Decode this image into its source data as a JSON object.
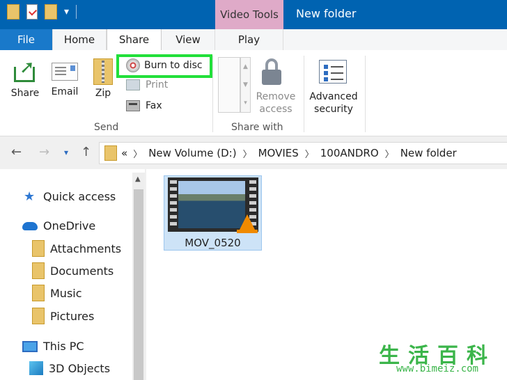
{
  "titlebar": {
    "context_tab": "Video Tools",
    "window_title": "New folder",
    "accent_color": "#0063b1",
    "context_color": "#dfaac8"
  },
  "tabs": {
    "file": "File",
    "home": "Home",
    "share": "Share",
    "view": "View",
    "play": "Play"
  },
  "ribbon": {
    "send": {
      "share": "Share",
      "email": "Email",
      "zip": "Zip",
      "burn": "Burn to disc",
      "print": "Print",
      "fax": "Fax",
      "group_label": "Send"
    },
    "share_with": {
      "remove_line1": "Remove",
      "remove_line2": "access",
      "advanced_line1": "Advanced",
      "advanced_line2": "security",
      "group_label": "Share with"
    },
    "highlight_color": "#22e03a"
  },
  "address": {
    "overflow": "«",
    "crumbs": [
      "New Volume (D:)",
      "MOVIES",
      "100ANDRO",
      "New folder"
    ]
  },
  "nav": {
    "quick_access": "Quick access",
    "onedrive": "OneDrive",
    "folders": [
      "Attachments",
      "Documents",
      "Music",
      "Pictures"
    ],
    "this_pc": "This PC",
    "objects_3d": "3D Objects"
  },
  "files": [
    {
      "name": "MOV_0520",
      "icon": "vlc-cone-icon"
    }
  ],
  "watermark": {
    "chars": "生活百科",
    "url": "www.bimeiz.com"
  }
}
